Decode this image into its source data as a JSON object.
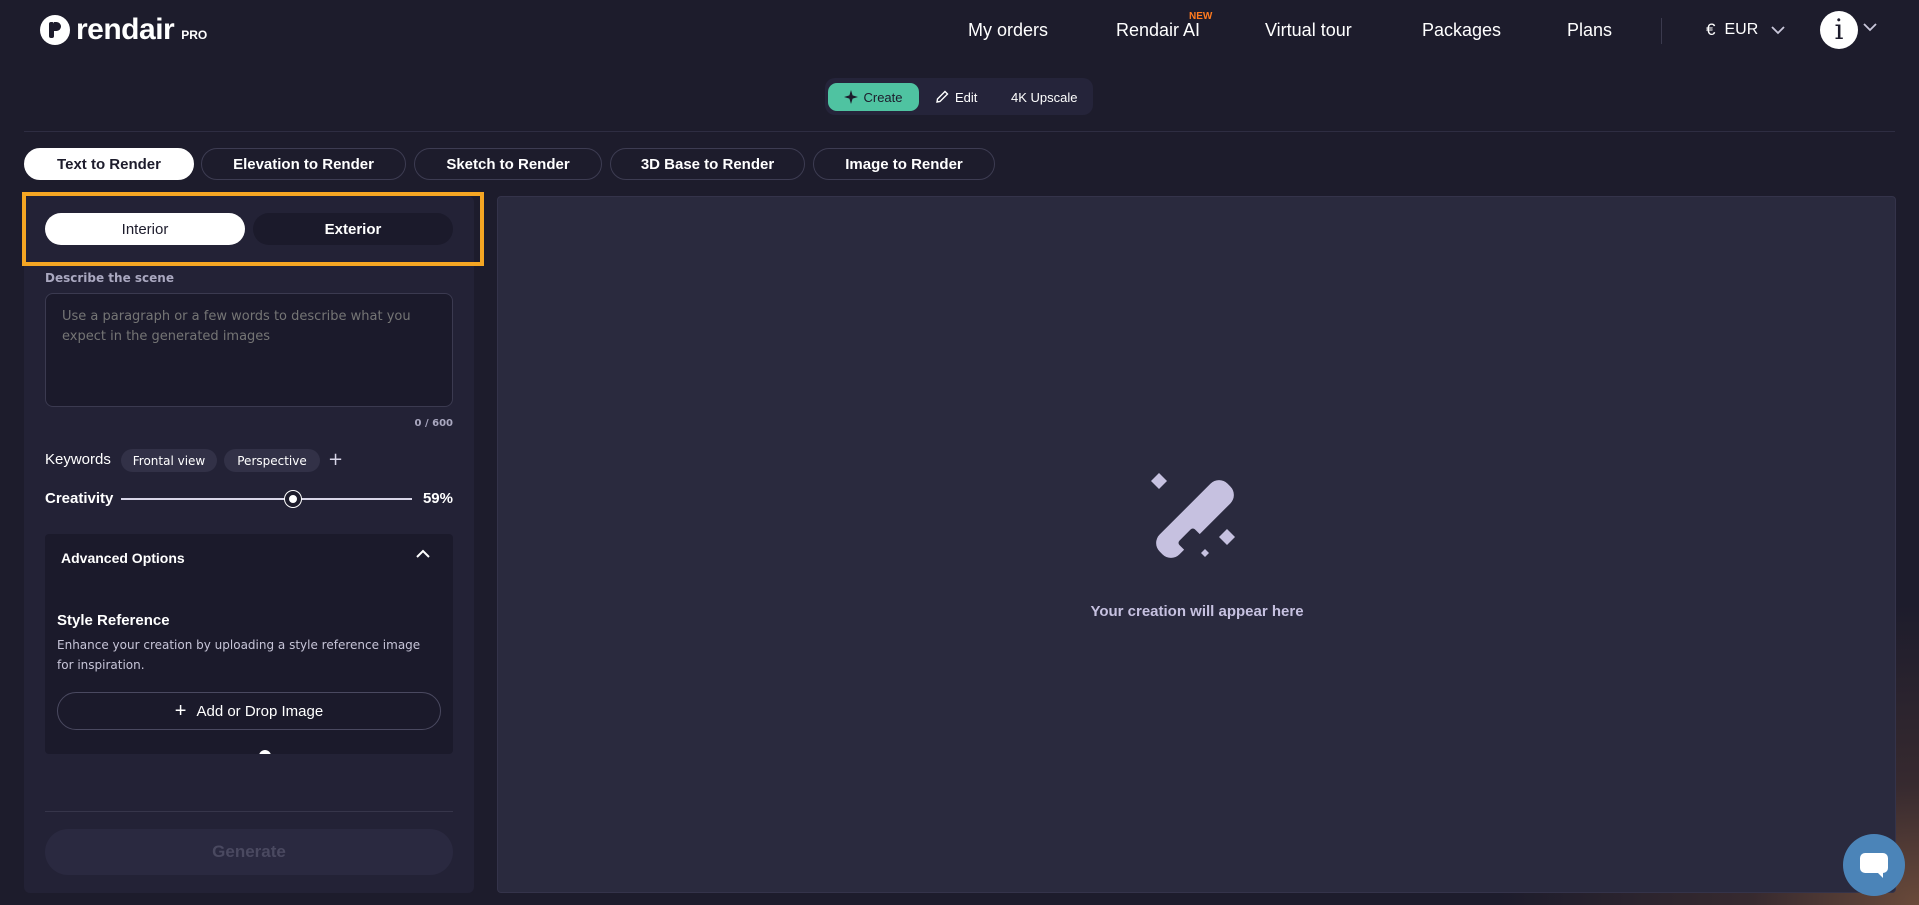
{
  "header": {
    "logo_text": "rendair",
    "logo_badge": "PRO",
    "nav": [
      "My orders",
      "Rendair AI",
      "Virtual tour",
      "Packages",
      "Plans"
    ],
    "new_badge": "NEW",
    "currency_symbol": "€",
    "currency": "EUR",
    "avatar_letter": "i"
  },
  "mode_switch": {
    "create": "Create",
    "edit": "Edit",
    "upscale": "4K Upscale"
  },
  "tabs": [
    "Text to Render",
    "Elevation to Render",
    "Sketch to Render",
    "3D Base to Render",
    "Image to Render"
  ],
  "left_panel": {
    "segments": [
      "Interior",
      "Exterior"
    ],
    "describe_label": "Describe the scene",
    "describe_placeholder": "Use a paragraph or a few words to describe what you expect in the generated images",
    "char_counter": "0 / 600",
    "keywords_label": "Keywords",
    "keywords": [
      "Frontal view",
      "Perspective"
    ],
    "add_keyword": "+",
    "creativity_label": "Creativity",
    "creativity_value": "59%",
    "creativity_level": 0.59,
    "advanced_title": "Advanced Options",
    "style_reference_title": "Style Reference",
    "style_reference_desc": "Enhance your creation by uploading a style reference image for inspiration.",
    "add_image": "Add or Drop Image",
    "generate": "Generate"
  },
  "right_panel": {
    "placeholder": "Your creation will appear here"
  },
  "colors": {
    "accent_green": "#4fc3a1",
    "highlight_orange": "#f5a623",
    "new_badge": "#ff7a1f"
  }
}
